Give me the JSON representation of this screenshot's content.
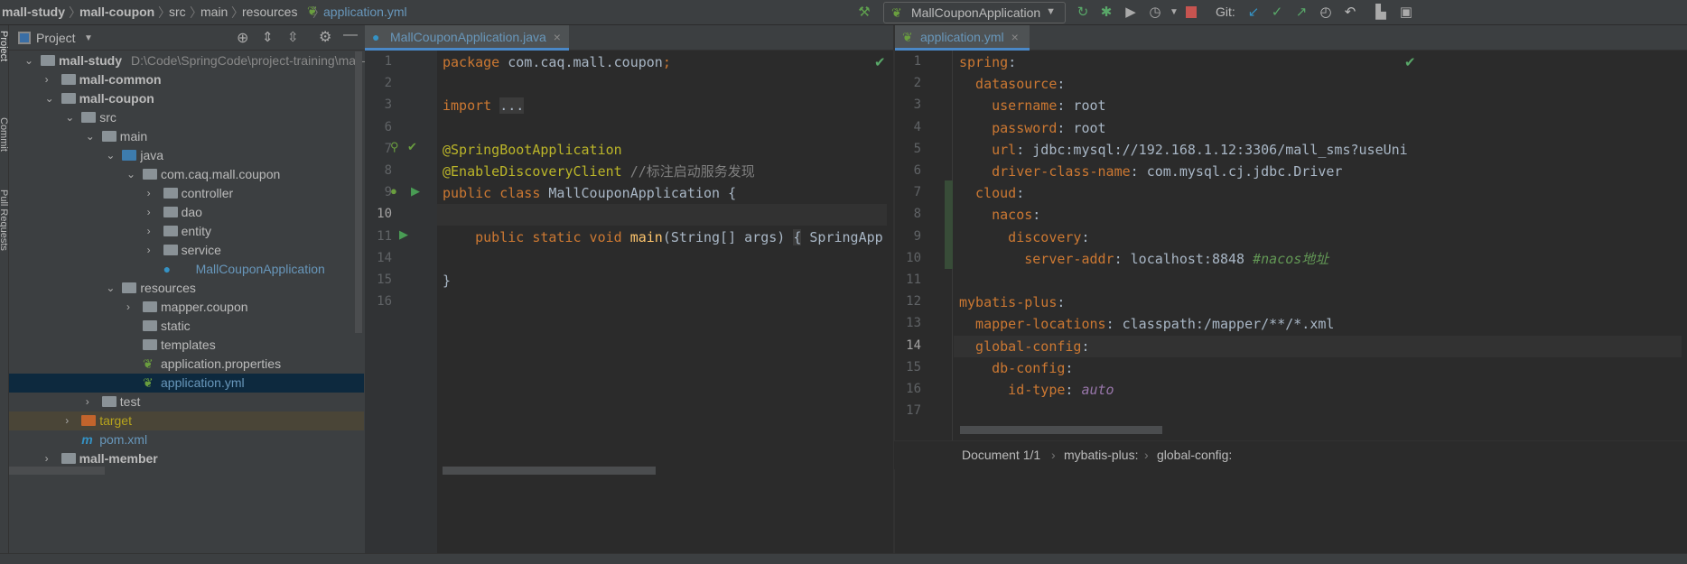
{
  "breadcrumb": [
    "mall-study",
    "mall-coupon",
    "src",
    "main",
    "resources",
    "application.yml"
  ],
  "toolbar": {
    "run_config": "MallCouponApplication",
    "git_label": "Git:",
    "icons": [
      "build-hammer-icon",
      "rerun-icon",
      "debug-icon",
      "coverage-icon",
      "profile-icon",
      "stop-icon",
      "git-update-icon",
      "git-commit-icon",
      "git-push-icon",
      "history-icon",
      "rollback-icon",
      "project-structure-icon",
      "terminal-icon"
    ]
  },
  "side_tools": [
    "Project",
    "Commit",
    "Pull Requests"
  ],
  "project": {
    "title": "Project",
    "tree": [
      {
        "label": "mall-study",
        "path": "D:\\Code\\SpringCode\\project-training\\mall-s",
        "depth": 0,
        "arrow": "open",
        "icon": "module",
        "bold": true
      },
      {
        "label": "mall-common",
        "depth": 1,
        "arrow": "closed",
        "icon": "module",
        "bold": true
      },
      {
        "label": "mall-coupon",
        "depth": 1,
        "arrow": "open",
        "icon": "module",
        "bold": true
      },
      {
        "label": "src",
        "depth": 2,
        "arrow": "open",
        "icon": "folder"
      },
      {
        "label": "main",
        "depth": 3,
        "arrow": "open",
        "icon": "folder"
      },
      {
        "label": "java",
        "depth": 4,
        "arrow": "open",
        "icon": "source-folder"
      },
      {
        "label": "com.caq.mall.coupon",
        "depth": 5,
        "arrow": "open",
        "icon": "package"
      },
      {
        "label": "controller",
        "depth": 6,
        "arrow": "closed",
        "icon": "package"
      },
      {
        "label": "dao",
        "depth": 6,
        "arrow": "closed",
        "icon": "package"
      },
      {
        "label": "entity",
        "depth": 6,
        "arrow": "closed",
        "icon": "package"
      },
      {
        "label": "service",
        "depth": 6,
        "arrow": "closed",
        "icon": "package"
      },
      {
        "label": "MallCouponApplication",
        "depth": 6,
        "arrow": "none",
        "icon": "spring-class",
        "color": "#6897bb"
      },
      {
        "label": "resources",
        "depth": 4,
        "arrow": "open",
        "icon": "resources-folder"
      },
      {
        "label": "mapper.coupon",
        "depth": 5,
        "arrow": "closed",
        "icon": "folder"
      },
      {
        "label": "static",
        "depth": 5,
        "arrow": "none",
        "icon": "folder"
      },
      {
        "label": "templates",
        "depth": 5,
        "arrow": "none",
        "icon": "folder"
      },
      {
        "label": "application.properties",
        "depth": 5,
        "arrow": "none",
        "icon": "spring-config"
      },
      {
        "label": "application.yml",
        "depth": 5,
        "arrow": "none",
        "icon": "spring-config",
        "selected": true,
        "color": "#6897bb"
      },
      {
        "label": "test",
        "depth": 3,
        "arrow": "closed",
        "icon": "folder"
      },
      {
        "label": "target",
        "depth": 2,
        "arrow": "closed",
        "icon": "excluded-folder",
        "excluded": true,
        "color": "#b7a41d"
      },
      {
        "label": "pom.xml",
        "depth": 2,
        "arrow": "none",
        "icon": "maven",
        "color": "#6897bb"
      },
      {
        "label": "mall-member",
        "depth": 1,
        "arrow": "closed",
        "icon": "module",
        "bold": true
      }
    ]
  },
  "java_editor": {
    "tab": "MallCouponApplication.java",
    "current_line": "10",
    "lines": [
      {
        "n": "1",
        "tokens": [
          {
            "t": "package ",
            "c": "kw"
          },
          {
            "t": "com.caq.mall.coupon",
            "c": "pl"
          },
          {
            "t": ";",
            "c": "kw"
          }
        ]
      },
      {
        "n": "2",
        "tokens": []
      },
      {
        "n": "3",
        "tokens": [
          {
            "t": "import ",
            "c": "kw"
          },
          {
            "t": "...",
            "c": "fold"
          }
        ]
      },
      {
        "n": "6",
        "tokens": []
      },
      {
        "n": "7",
        "tokens": [
          {
            "t": "@SpringBootApplication",
            "c": "ann"
          }
        ]
      },
      {
        "n": "8",
        "tokens": [
          {
            "t": "@EnableDiscoveryClient",
            "c": "ann"
          },
          {
            "t": " //标注启动服务发现",
            "c": "cm"
          }
        ]
      },
      {
        "n": "9",
        "tokens": [
          {
            "t": "public class ",
            "c": "kw"
          },
          {
            "t": "MallCouponApplication {",
            "c": "pl"
          }
        ]
      },
      {
        "n": "10",
        "tokens": []
      },
      {
        "n": "11",
        "tokens": [
          {
            "t": "    public static void ",
            "c": "kw"
          },
          {
            "t": "main",
            "c": "fn"
          },
          {
            "t": "(String[] args) ",
            "c": "pl"
          },
          {
            "t": "{",
            "c": "fold"
          },
          {
            "t": " SpringApp",
            "c": "pl"
          }
        ]
      },
      {
        "n": "14",
        "tokens": []
      },
      {
        "n": "15",
        "tokens": [
          {
            "t": "}",
            "c": "pl"
          }
        ]
      },
      {
        "n": "16",
        "tokens": []
      }
    ]
  },
  "yml_editor": {
    "tab": "application.yml",
    "current_line": "14",
    "lines": [
      {
        "n": "1",
        "tokens": [
          {
            "t": "spring",
            "c": "yk"
          },
          {
            "t": ":",
            "c": "pl"
          }
        ]
      },
      {
        "n": "2",
        "tokens": [
          {
            "t": "  datasource",
            "c": "yk"
          },
          {
            "t": ":",
            "c": "pl"
          }
        ]
      },
      {
        "n": "3",
        "tokens": [
          {
            "t": "    username",
            "c": "yk"
          },
          {
            "t": ": root",
            "c": "pl"
          }
        ]
      },
      {
        "n": "4",
        "tokens": [
          {
            "t": "    password",
            "c": "yk"
          },
          {
            "t": ": root",
            "c": "pl"
          }
        ]
      },
      {
        "n": "5",
        "tokens": [
          {
            "t": "    url",
            "c": "yk"
          },
          {
            "t": ": jdbc:mysql://192.168.1.12:3306/mall_sms?useUni",
            "c": "pl"
          }
        ]
      },
      {
        "n": "6",
        "tokens": [
          {
            "t": "    driver-class-name",
            "c": "yk"
          },
          {
            "t": ": com.mysql.cj.jdbc.Driver",
            "c": "pl"
          }
        ]
      },
      {
        "n": "7",
        "tokens": [
          {
            "t": "  cloud",
            "c": "yk"
          },
          {
            "t": ":",
            "c": "pl"
          }
        ]
      },
      {
        "n": "8",
        "tokens": [
          {
            "t": "    nacos",
            "c": "yk"
          },
          {
            "t": ":",
            "c": "pl"
          }
        ]
      },
      {
        "n": "9",
        "tokens": [
          {
            "t": "      discovery",
            "c": "yk"
          },
          {
            "t": ":",
            "c": "pl"
          }
        ]
      },
      {
        "n": "10",
        "tokens": [
          {
            "t": "        server-addr",
            "c": "yk"
          },
          {
            "t": ": localhost:8848 ",
            "c": "pl"
          },
          {
            "t": "#nacos地址",
            "c": "yc"
          }
        ]
      },
      {
        "n": "11",
        "tokens": []
      },
      {
        "n": "12",
        "tokens": [
          {
            "t": "mybatis-plus",
            "c": "yk"
          },
          {
            "t": ":",
            "c": "pl"
          }
        ]
      },
      {
        "n": "13",
        "tokens": [
          {
            "t": "  mapper-locations",
            "c": "yk"
          },
          {
            "t": ": classpath:/mapper/**/*.xml",
            "c": "pl"
          }
        ]
      },
      {
        "n": "14",
        "tokens": [
          {
            "t": "  global-config",
            "c": "yk"
          },
          {
            "t": ":",
            "c": "pl"
          }
        ]
      },
      {
        "n": "15",
        "tokens": [
          {
            "t": "    db-config",
            "c": "yk"
          },
          {
            "t": ":",
            "c": "pl"
          }
        ]
      },
      {
        "n": "16",
        "tokens": [
          {
            "t": "      id-type",
            "c": "yk"
          },
          {
            "t": ": ",
            "c": "pl"
          },
          {
            "t": "auto",
            "c": "ya"
          }
        ]
      },
      {
        "n": "17",
        "tokens": []
      }
    ],
    "breadcrumb": [
      "Document 1/1",
      "mybatis-plus:",
      "global-config:"
    ]
  },
  "colors": {
    "accent": "#4a88c7",
    "selection": "#0d293e",
    "spring_green": "#6a9e3f"
  }
}
